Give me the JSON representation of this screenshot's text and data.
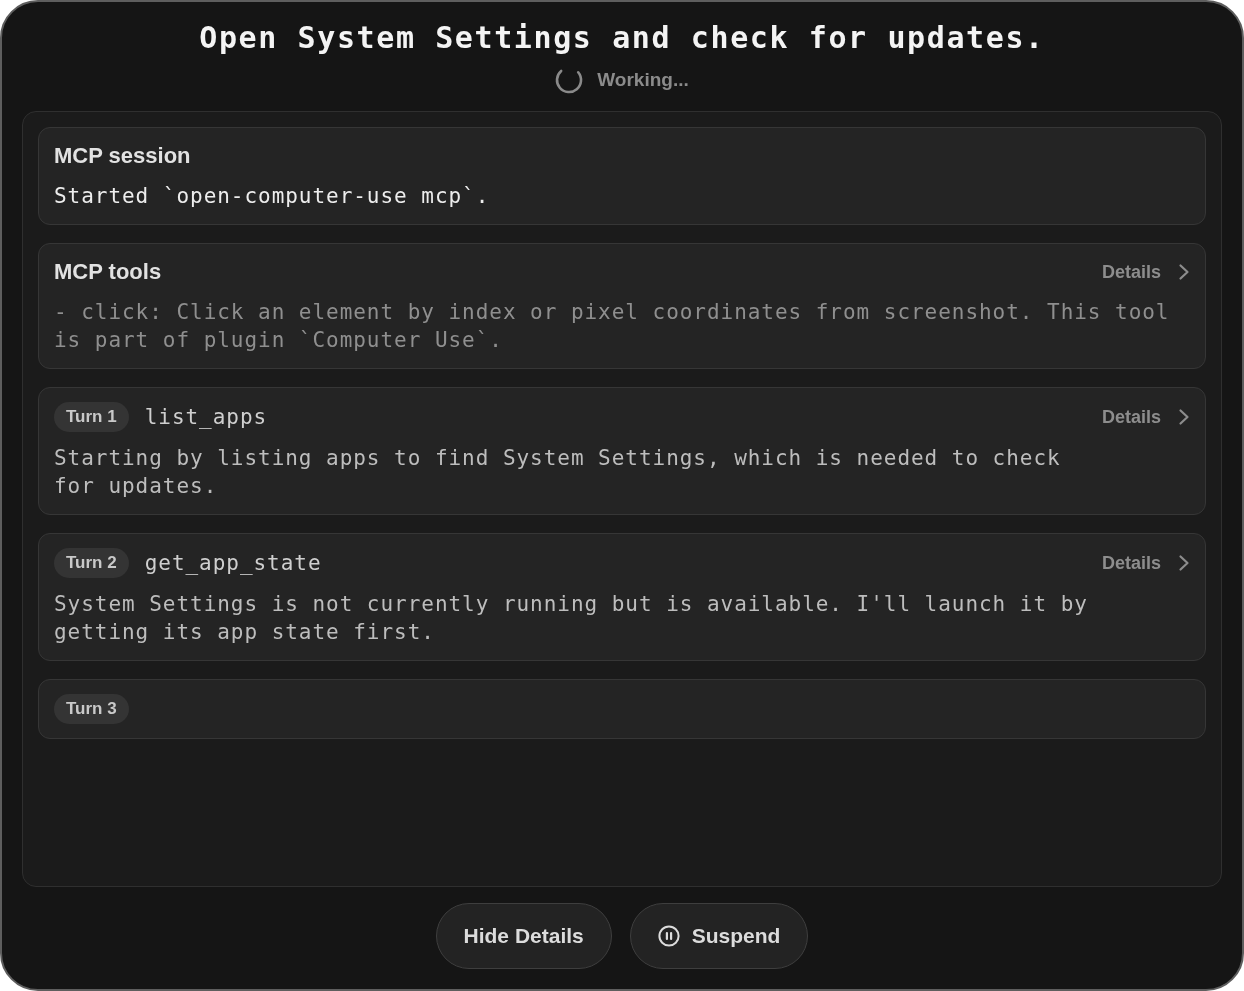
{
  "header": {
    "title": "Open System Settings and check for updates.",
    "status": "Working..."
  },
  "cards": [
    {
      "kind": "session",
      "title": "MCP session",
      "body": "Started `open-computer-use mcp`."
    },
    {
      "kind": "tools",
      "title": "MCP tools",
      "details": "Details",
      "body": "- click: Click an element by index or pixel coordinates from screenshot. This tool is part of plugin `Computer Use`."
    },
    {
      "kind": "turn",
      "badge": "Turn 1",
      "tool": "list_apps",
      "details": "Details",
      "body": "Starting by listing apps to find System Settings, which is needed to check for updates."
    },
    {
      "kind": "turn",
      "badge": "Turn 2",
      "tool": "get_app_state",
      "details": "Details",
      "body": "System Settings is not currently running but is available. I'll launch it by getting its app state first."
    },
    {
      "kind": "turn",
      "badge": "Turn 3"
    }
  ],
  "buttons": [
    {
      "kind": "toggle",
      "label": "Hide Details"
    },
    {
      "kind": "suspend",
      "label": "Suspend"
    }
  ]
}
